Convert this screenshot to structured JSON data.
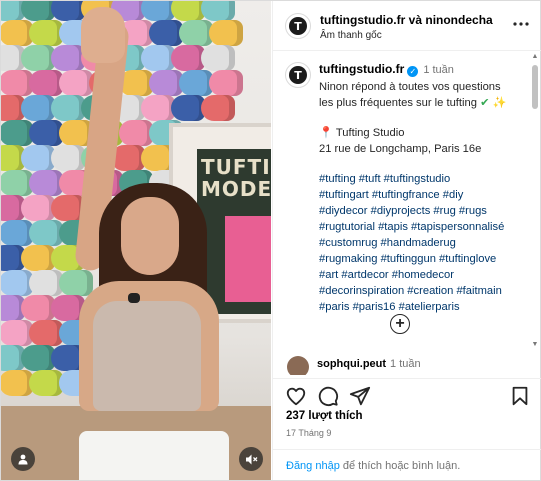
{
  "post_header": {
    "account": "tuftingstudio.fr",
    "connector": "và",
    "collaborator": "ninondecha",
    "audio": "Âm thanh gốc",
    "avatar_letter": "T"
  },
  "caption": {
    "author": "tuftingstudio.fr",
    "time": "1 tuần",
    "verified_glyph": "✓",
    "lines": [
      "Ninon répond à toutes vos questions",
      "les plus fréquentes sur le tufting "
    ],
    "emoji_check": "✔",
    "emoji_sparkle": "✨",
    "pin_glyph": "📍",
    "location_name": "Tufting Studio",
    "address": "21 rue de Longchamp, Paris 16e",
    "hashtags": [
      "#tufting #tuft #tuftingstudio",
      "#tuftingart #tuftingfrance #diy",
      "#diydecor #diyprojects #rug #rugs",
      "#rugtutorial #tapis #tapispersonnalisé",
      "#customrug #handmaderug",
      "#rugmaking #tuftinggun #tuftinglove",
      "#art #artdecor #homedecor",
      "#decorinspiration #creation #faitmain",
      "#paris #paris16 #atelierparis"
    ],
    "load_more_glyph": "+"
  },
  "comment": {
    "author": "sophqui.peut",
    "time": "1 tuần"
  },
  "media": {
    "rug_text_1": "TUFTI",
    "rug_text_2": "MODE"
  },
  "stats": {
    "likes": "237 lượt thích",
    "date": "17 Tháng 9"
  },
  "footer": {
    "login_link": "Đăng nhập",
    "login_rest": " để thích hoặc bình luận."
  },
  "icons": {
    "more": "more-horizontal-icon",
    "like": "heart-icon",
    "comment": "comment-bubble-icon",
    "share": "paper-plane-icon",
    "save": "bookmark-icon",
    "user": "user-tag-icon",
    "mute": "speaker-muted-icon"
  },
  "colors": {
    "link_blue": "#0095f6",
    "hashtag": "#00376b",
    "muted_text": "#737373",
    "verified": "#0095f6"
  }
}
